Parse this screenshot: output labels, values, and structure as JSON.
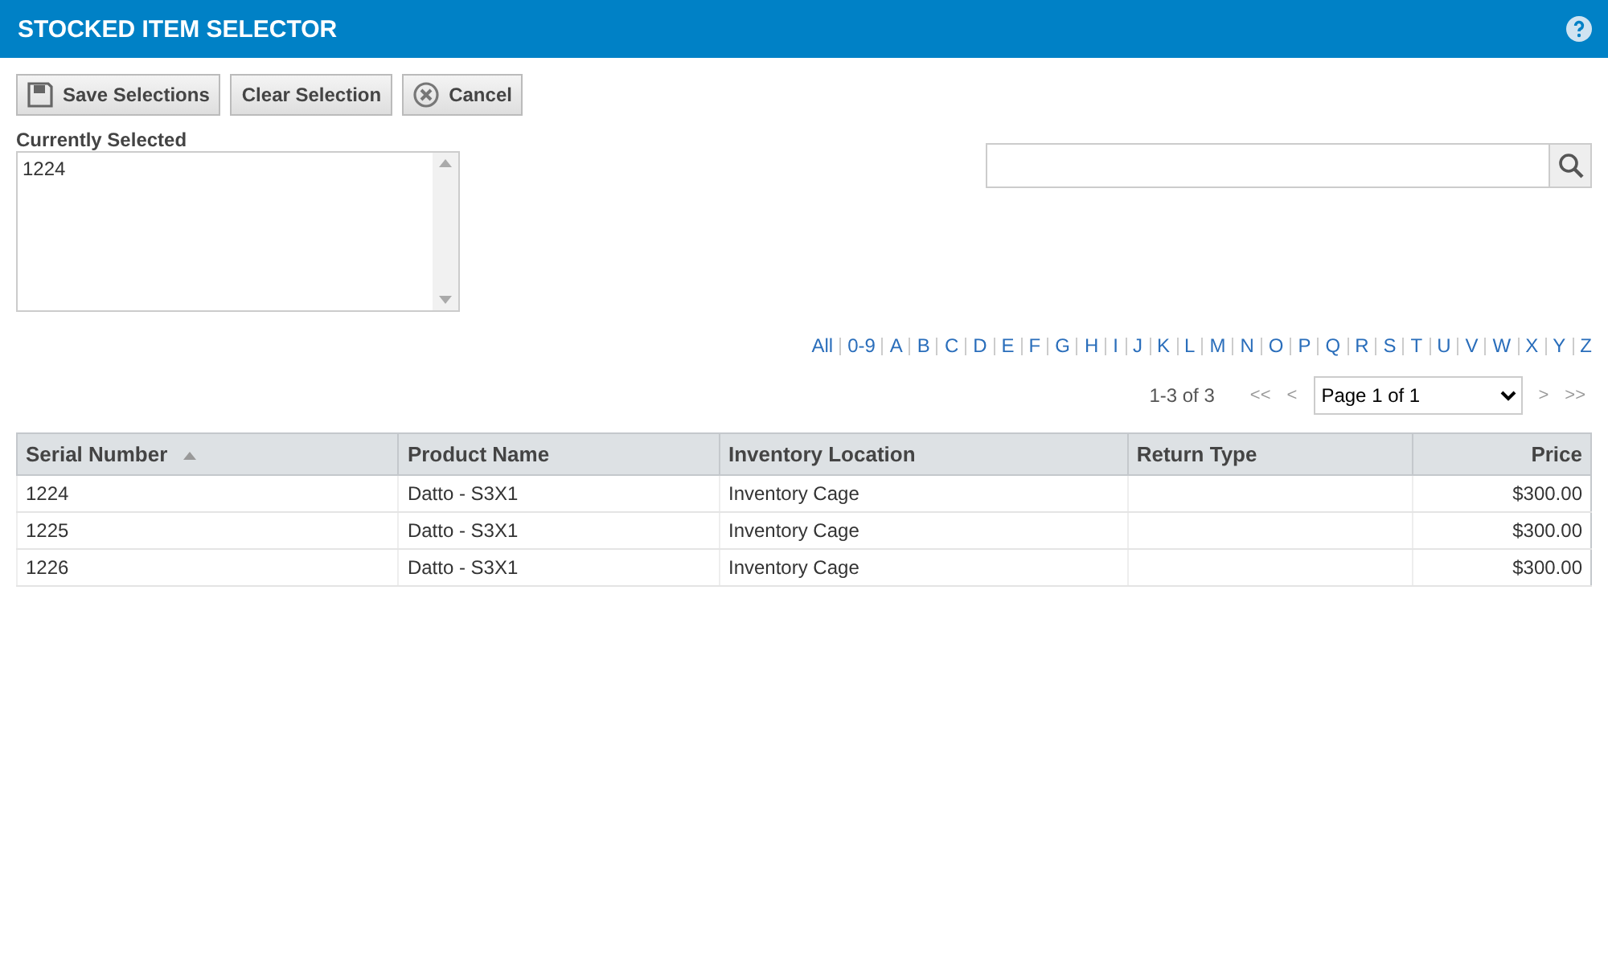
{
  "window": {
    "title": "STOCKED ITEM SELECTOR"
  },
  "toolbar": [
    {
      "label": "Save Selections",
      "kind": "save"
    },
    {
      "label": "Clear Selection",
      "kind": "plain"
    },
    {
      "label": "Cancel",
      "kind": "cancel"
    }
  ],
  "selected_box": {
    "label": "Currently Selected",
    "value": "1224"
  },
  "alphabet": [
    "All",
    "0-9",
    "A",
    "B",
    "C",
    "D",
    "E",
    "F",
    "G",
    "H",
    "I",
    "J",
    "K",
    "L",
    "M",
    "N",
    "O",
    "P",
    "Q",
    "R",
    "S",
    "T",
    "U",
    "V",
    "W",
    "X",
    "Y",
    "Z"
  ],
  "pager": {
    "summary": "1-3 of 3",
    "first": "<<",
    "prev": "<",
    "page": "Page 1 of 1",
    "next": ">",
    "last": ">>"
  },
  "table": {
    "columns": [
      {
        "label": "Serial Number",
        "sorted": true,
        "kind": "text"
      },
      {
        "label": "Product Name",
        "sorted": false,
        "kind": "text"
      },
      {
        "label": "Inventory Location",
        "sorted": false,
        "kind": "text"
      },
      {
        "label": "Return Type",
        "sorted": false,
        "kind": "text"
      },
      {
        "label": "Price",
        "sorted": false,
        "kind": "amount"
      }
    ],
    "rows": [
      [
        "1224",
        "Datto - S3X1",
        "Inventory Cage",
        "",
        "$300.00"
      ],
      [
        "1225",
        "Datto - S3X1",
        "Inventory Cage",
        "",
        "$300.00"
      ],
      [
        "1226",
        "Datto - S3X1",
        "Inventory Cage",
        "",
        "$300.00"
      ]
    ]
  }
}
